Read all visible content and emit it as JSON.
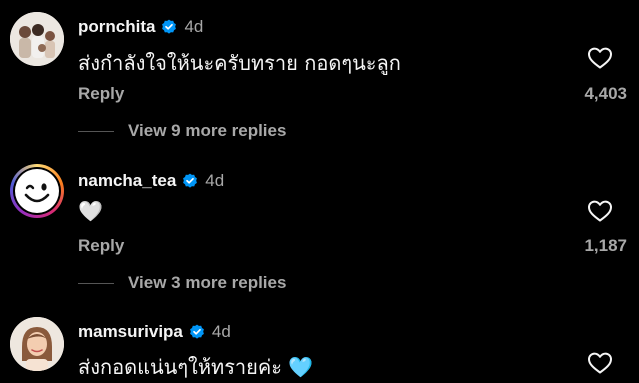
{
  "comments": [
    {
      "username": "pornchita",
      "time": "4d",
      "text": "ส่งกำลังใจให้นะครับทราย กอดๆนะลูก",
      "reply_label": "Reply",
      "likes": "4,403",
      "view_more": "View 9 more replies",
      "avatar_icon": "family-photo-avatar"
    },
    {
      "username": "namcha_tea",
      "time": "4d",
      "text": "🤍",
      "reply_label": "Reply",
      "likes": "1,187",
      "view_more": "View 3 more replies",
      "avatar_icon": "smiley-face-avatar"
    },
    {
      "username": "mamsurivipa",
      "time": "4d",
      "text": "ส่งกอดแน่นๆให้ทรายค่ะ 🩵",
      "avatar_icon": "woman-photo-avatar"
    }
  ],
  "colors": {
    "background": "#000000",
    "primary_text": "#f5f5f5",
    "secondary_text": "#a8a8a8",
    "verified_badge": "#0095f6",
    "story_ring": [
      "#feda75",
      "#fa7e1e",
      "#d62976",
      "#962fbf"
    ]
  }
}
